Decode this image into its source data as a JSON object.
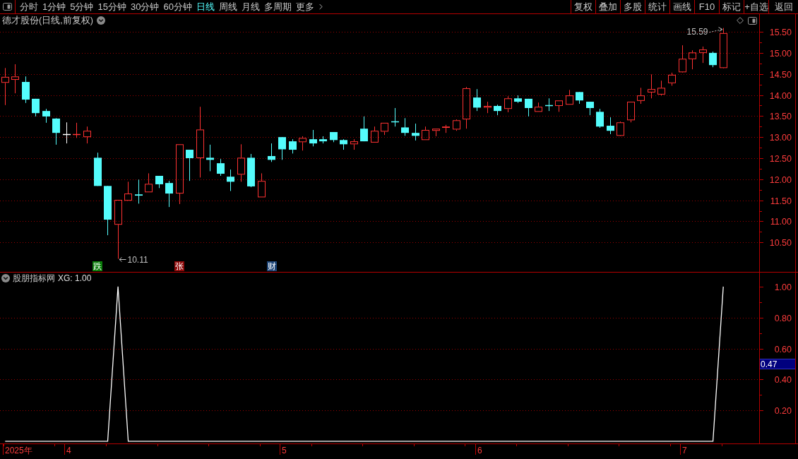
{
  "toolbar": {
    "tabs": [
      {
        "label": "分时",
        "kind": "period",
        "selected": false
      },
      {
        "label": "1分钟",
        "kind": "period",
        "selected": false
      },
      {
        "label": "5分钟",
        "kind": "period",
        "selected": false
      },
      {
        "label": "15分钟",
        "kind": "period",
        "selected": false
      },
      {
        "label": "30分钟",
        "kind": "period",
        "selected": false
      },
      {
        "label": "60分钟",
        "kind": "period",
        "selected": false
      },
      {
        "label": "日线",
        "kind": "period",
        "selected": true
      },
      {
        "label": "周线",
        "kind": "period",
        "selected": false
      },
      {
        "label": "月线",
        "kind": "period",
        "selected": false
      },
      {
        "label": "多周期",
        "kind": "period",
        "selected": false
      },
      {
        "label": "更多",
        "kind": "menu",
        "selected": false
      }
    ],
    "buttons": [
      "复权",
      "叠加",
      "多股",
      "统计",
      "画线",
      "F10",
      "标记",
      "+自选",
      "返回"
    ]
  },
  "main_chart": {
    "title": "德才股份(日线,前复权)",
    "markers": [
      {
        "label": "跌",
        "color": "#0a7d0a"
      },
      {
        "label": "张",
        "color": "#8e0a0a"
      },
      {
        "label": "财",
        "color": "#1c4476"
      }
    ],
    "chart_data": {
      "type": "candlestick",
      "grid": true,
      "ylim": [
        9.8,
        15.92
      ],
      "yticks": [
        {
          "value": 15.5,
          "label": "15.50"
        },
        {
          "value": 15,
          "label": "15.00"
        },
        {
          "value": 14.5,
          "label": "14.50"
        },
        {
          "value": 14,
          "label": "14.00"
        },
        {
          "value": 13.5,
          "label": "13.50"
        },
        {
          "value": 13,
          "label": "13.00"
        },
        {
          "value": 12.5,
          "label": "12.50"
        },
        {
          "value": 12,
          "label": "12.00"
        },
        {
          "value": 11.5,
          "label": "11.50"
        },
        {
          "value": 11,
          "label": "11.00"
        },
        {
          "value": 10.5,
          "label": "10.50"
        }
      ],
      "annotations": [
        "15.59",
        "10.11"
      ],
      "categories": [
        null,
        null,
        null,
        null,
        null,
        null,
        null,
        null,
        null,
        null,
        null,
        null,
        null,
        null,
        null,
        null,
        null,
        null,
        null,
        null,
        null,
        null,
        null,
        null,
        null,
        null,
        null,
        null,
        null,
        null,
        null,
        null,
        null,
        null,
        null,
        null,
        null,
        null,
        null,
        null,
        null,
        null,
        null,
        null,
        null,
        null,
        null,
        null,
        null,
        null,
        null,
        null,
        null,
        null,
        null,
        null,
        null,
        null,
        null,
        null,
        null,
        null,
        null,
        null,
        null,
        null,
        null,
        null,
        null,
        null,
        null,
        null,
        null,
        null
      ],
      "ohlc": [
        [
          14.29,
          14.64,
          13.76,
          14.43
        ],
        [
          14.36,
          14.73,
          14.04,
          14.44
        ],
        [
          14.31,
          14.44,
          13.81,
          13.89
        ],
        [
          13.91,
          13.91,
          13.49,
          13.57
        ],
        [
          13.62,
          13.67,
          13.34,
          13.49
        ],
        [
          13.44,
          13.45,
          12.82,
          13.1
        ],
        [
          13.07,
          13.35,
          12.85,
          13.07
        ],
        [
          13.07,
          13.34,
          12.98,
          13.08
        ],
        [
          13.0,
          13.25,
          12.85,
          13.15
        ],
        [
          12.51,
          12.63,
          11.84,
          11.84
        ],
        [
          11.84,
          11.84,
          10.67,
          11.04
        ],
        [
          10.92,
          11.51,
          10.11,
          11.51
        ],
        [
          11.49,
          11.94,
          11.49,
          11.66
        ],
        [
          11.64,
          11.99,
          11.42,
          11.61
        ],
        [
          11.69,
          12.14,
          11.69,
          11.89
        ],
        [
          12.08,
          12.08,
          11.79,
          11.88
        ],
        [
          11.91,
          11.96,
          11.34,
          11.66
        ],
        [
          11.66,
          12.83,
          11.41,
          12.83
        ],
        [
          12.7,
          12.7,
          11.96,
          12.5
        ],
        [
          12.5,
          13.72,
          12.04,
          13.18
        ],
        [
          12.51,
          12.82,
          12.19,
          12.46
        ],
        [
          12.38,
          12.48,
          12.08,
          12.13
        ],
        [
          12.06,
          12.23,
          11.72,
          11.94
        ],
        [
          12.11,
          12.83,
          11.94,
          12.51
        ],
        [
          12.51,
          12.6,
          11.81,
          11.83
        ],
        [
          11.57,
          12.14,
          11.57,
          11.96
        ],
        [
          12.55,
          12.85,
          12.41,
          12.46
        ],
        [
          13.0,
          13.0,
          12.46,
          12.71
        ],
        [
          12.9,
          12.95,
          12.61,
          12.7
        ],
        [
          12.88,
          13.02,
          12.68,
          12.98
        ],
        [
          12.95,
          13.17,
          12.78,
          12.85
        ],
        [
          12.95,
          13.02,
          12.85,
          12.9
        ],
        [
          13.12,
          13.12,
          12.88,
          12.93
        ],
        [
          12.93,
          12.95,
          12.7,
          12.83
        ],
        [
          12.83,
          12.95,
          12.7,
          12.9
        ],
        [
          13.2,
          13.49,
          12.9,
          12.9
        ],
        [
          12.87,
          13.25,
          12.87,
          13.15
        ],
        [
          13.13,
          13.34,
          13.05,
          13.34
        ],
        [
          13.37,
          13.69,
          13.25,
          13.36
        ],
        [
          13.23,
          13.45,
          13.03,
          13.1
        ],
        [
          13.1,
          13.32,
          12.92,
          13.03
        ],
        [
          12.93,
          13.25,
          12.93,
          13.17
        ],
        [
          13.15,
          13.2,
          13.02,
          13.2
        ],
        [
          13.22,
          13.29,
          13.1,
          13.25
        ],
        [
          13.18,
          13.42,
          13.15,
          13.4
        ],
        [
          13.42,
          14.19,
          13.2,
          14.16
        ],
        [
          13.94,
          14.14,
          13.62,
          13.7
        ],
        [
          13.7,
          13.84,
          13.57,
          13.74
        ],
        [
          13.74,
          13.77,
          13.52,
          13.62
        ],
        [
          13.67,
          13.97,
          13.59,
          13.92
        ],
        [
          13.92,
          13.99,
          13.81,
          13.84
        ],
        [
          13.91,
          13.91,
          13.49,
          13.69
        ],
        [
          13.6,
          13.82,
          13.6,
          13.72
        ],
        [
          13.77,
          13.92,
          13.62,
          13.76
        ],
        [
          13.74,
          13.87,
          13.6,
          13.87
        ],
        [
          13.77,
          14.12,
          13.77,
          13.99
        ],
        [
          14.07,
          14.07,
          13.79,
          13.87
        ],
        [
          13.84,
          13.84,
          13.52,
          13.69
        ],
        [
          13.6,
          13.67,
          13.22,
          13.25
        ],
        [
          13.27,
          13.47,
          13.07,
          13.15
        ],
        [
          13.03,
          13.37,
          13.02,
          13.35
        ],
        [
          13.4,
          13.84,
          13.35,
          13.84
        ],
        [
          13.86,
          14.17,
          13.79,
          13.99
        ],
        [
          14.06,
          14.49,
          13.92,
          14.14
        ],
        [
          14.01,
          14.34,
          13.99,
          14.17
        ],
        [
          14.28,
          14.53,
          14.22,
          14.48
        ],
        [
          14.54,
          15.18,
          14.53,
          14.86
        ],
        [
          14.85,
          15.06,
          14.61,
          15.01
        ],
        [
          15.0,
          15.15,
          14.76,
          15.08
        ],
        [
          15.0,
          15.03,
          14.66,
          14.71
        ],
        [
          14.64,
          15.59,
          14.63,
          15.47
        ],
        null,
        null,
        null
      ]
    }
  },
  "indicator": {
    "name": "股朋指标网",
    "readout": "XG: 1.00",
    "cursor_value": "0.47",
    "chart_data": {
      "type": "line",
      "grid": true,
      "ylim": [
        -0.014,
        1.091
      ],
      "yticks": [
        {
          "value": 1,
          "label": "1.00"
        },
        {
          "value": 0.8,
          "label": "0.80"
        },
        {
          "value": 0.6,
          "label": "0.60"
        },
        {
          "value": 0.4,
          "label": "0.40"
        },
        {
          "value": 0.2,
          "label": "0.20"
        }
      ],
      "categories": [
        null,
        null,
        null,
        null,
        null,
        null,
        null,
        null,
        null,
        null,
        null,
        null,
        null,
        null,
        null,
        null,
        null,
        null,
        null,
        null,
        null,
        null,
        null,
        null,
        null,
        null,
        null,
        null,
        null,
        null,
        null,
        null,
        null,
        null,
        null,
        null,
        null,
        null,
        null,
        null,
        null,
        null,
        null,
        null,
        null,
        null,
        null,
        null,
        null,
        null,
        null,
        null,
        null,
        null,
        null,
        null,
        null,
        null,
        null,
        null,
        null,
        null,
        null,
        null,
        null,
        null,
        null,
        null,
        null,
        null,
        null,
        null,
        null,
        null
      ],
      "series": [
        {
          "color": "#ffffff",
          "values": [
            0,
            0,
            0,
            0,
            0,
            0,
            0,
            0,
            0,
            0,
            0,
            1,
            0,
            0,
            0,
            0,
            0,
            0,
            0,
            0,
            0,
            0,
            0,
            0,
            0,
            0,
            0,
            0,
            0,
            0,
            0,
            0,
            0,
            0,
            0,
            0,
            0,
            0,
            0,
            0,
            0,
            0,
            0,
            0,
            0,
            0,
            0,
            0,
            0,
            0,
            0,
            0,
            0,
            0,
            0,
            0,
            0,
            0,
            0,
            0,
            0,
            0,
            0,
            0,
            0,
            0,
            0,
            0,
            0,
            0,
            1,
            null,
            null,
            null
          ]
        }
      ]
    }
  },
  "date_axis": {
    "labels": [
      "2025年",
      "4",
      "5",
      "6",
      "7"
    ]
  }
}
